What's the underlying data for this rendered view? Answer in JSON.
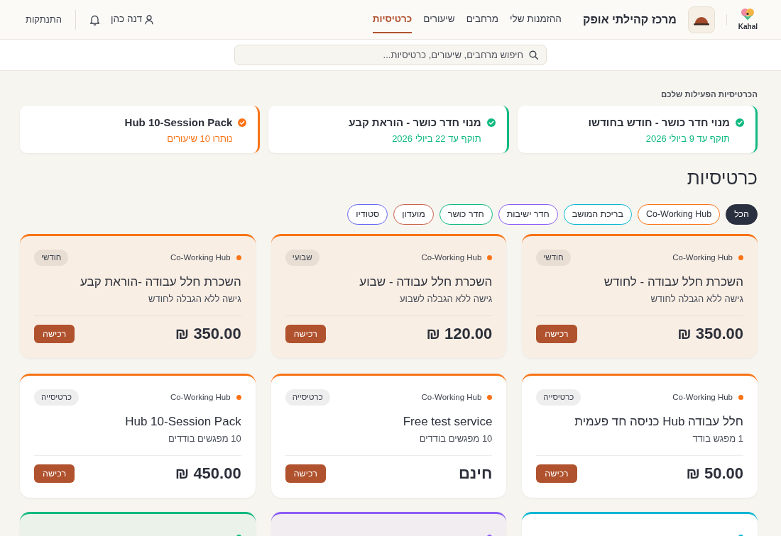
{
  "brand": {
    "name": "Kahal"
  },
  "organization": {
    "name": "מרכז קהילתי אופק"
  },
  "nav": [
    {
      "label": "ההזמנות שלי",
      "selected": false
    },
    {
      "label": "מרחבים",
      "selected": false
    },
    {
      "label": "שיעורים",
      "selected": false
    },
    {
      "label": "כרטיסיות",
      "selected": true
    }
  ],
  "user": {
    "name": "דנה כהן"
  },
  "logout": "התנתקות",
  "search": {
    "placeholder": "חיפוש מרחבים, שיעורים, כרטיסיות..."
  },
  "active_packages": {
    "title": "הכרטיסיות הפעילות שלכם",
    "items": [
      {
        "name": "מנוי חדר כושר - חודש בחודשו",
        "detail": "תוקף עד 9 ביולי 2026",
        "color": "#10b981"
      },
      {
        "name": "מנוי חדר כושר - הוראת קבע",
        "detail": "תוקף עד 22 ביולי 2026",
        "color": "#10b981"
      },
      {
        "name": "Hub 10-Session Pack",
        "detail": "נותרו 10 שיעורים",
        "color": "#f97316"
      }
    ]
  },
  "catalog": {
    "title": "כרטיסיות",
    "filters": [
      {
        "label": "הכל",
        "selected": true,
        "color": "#2b3040"
      },
      {
        "label": "Co-Working Hub",
        "selected": false,
        "color": "#f97316"
      },
      {
        "label": "בריכת המושב",
        "selected": false,
        "color": "#06b6d4"
      },
      {
        "label": "חדר ישיבות",
        "selected": false,
        "color": "#8b5cf6"
      },
      {
        "label": "חדר כושר",
        "selected": false,
        "color": "#10b981"
      },
      {
        "label": "מועדון",
        "selected": false,
        "color": "#c9604a"
      },
      {
        "label": "סטודיו",
        "selected": false,
        "color": "#6366f1"
      }
    ],
    "packages": [
      {
        "kind": "subscription",
        "category": "Co-Working Hub",
        "color": "#f97316",
        "badge": "חודשי",
        "title": "השכרת חלל עבודה - לחודש",
        "description": "גישה ללא הגבלה לחודש",
        "price": "350.00 ₪",
        "button": "רכישה"
      },
      {
        "kind": "subscription",
        "category": "Co-Working Hub",
        "color": "#f97316",
        "badge": "שבועי",
        "title": "השכרת חלל עבודה - שבוע",
        "description": "גישה ללא הגבלה לשבוע",
        "price": "120.00 ₪",
        "button": "רכישה"
      },
      {
        "kind": "subscription",
        "category": "Co-Working Hub",
        "color": "#f97316",
        "badge": "חודשי",
        "title": "השכרת חלל עבודה -הוראת קבע",
        "description": "גישה ללא הגבלה לחודש",
        "price": "350.00 ₪",
        "button": "רכישה"
      },
      {
        "kind": "pass",
        "category": "Co-Working Hub",
        "color": "#f97316",
        "badge": "כרטיסייה",
        "title": "חלל עבודה Hub כניסה חד פעמית",
        "description": "1 מפגש בודד",
        "price": "50.00 ₪",
        "button": "רכישה"
      },
      {
        "kind": "pass",
        "category": "Co-Working Hub",
        "color": "#f97316",
        "badge": "כרטיסייה",
        "title": "Free test service",
        "description": "10 מפגשים בודדים",
        "price": "חינם",
        "button": "רכישה"
      },
      {
        "kind": "pass",
        "category": "Co-Working Hub",
        "color": "#f97316",
        "badge": "כרטיסייה",
        "title": "Hub 10-Session Pack",
        "description": "10 מפגשים בודדים",
        "price": "450.00 ₪",
        "button": "רכישה"
      }
    ],
    "more_packages": [
      {
        "kind": "pass",
        "color": "#06b6d4"
      },
      {
        "kind": "subscription",
        "color": "#8b5cf6"
      },
      {
        "kind": "subscription",
        "color": "#10b981"
      }
    ]
  }
}
